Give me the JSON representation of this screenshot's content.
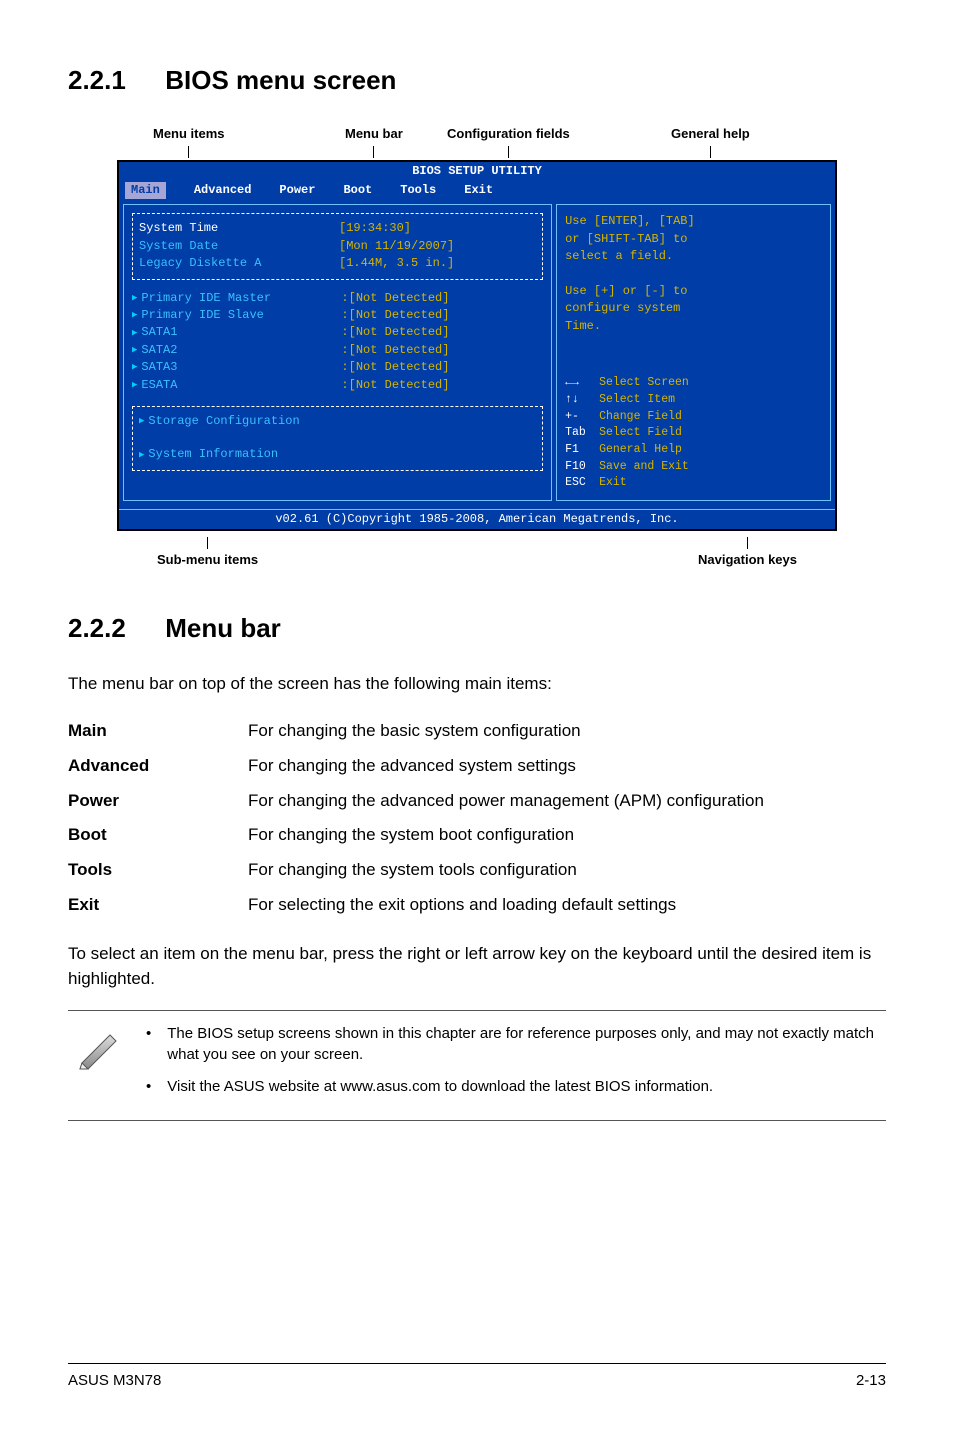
{
  "sections": {
    "s1": {
      "num": "2.2.1",
      "title": "BIOS menu screen"
    },
    "s2": {
      "num": "2.2.2",
      "title": "Menu bar"
    }
  },
  "diagram_labels": {
    "menu_items": "Menu items",
    "menu_bar": "Menu bar",
    "config_fields": "Configuration fields",
    "general_help": "General help",
    "submenu_items": "Sub-menu items",
    "nav_keys": "Navigation keys"
  },
  "bios": {
    "title": "BIOS SETUP UTILITY",
    "menus": [
      "Main",
      "Advanced",
      "Power",
      "Boot",
      "Tools",
      "Exit"
    ],
    "left_box1": [
      {
        "k": "System Time",
        "v": "[19:34:30]",
        "white": true
      },
      {
        "k": "System Date",
        "v": "[Mon 11/19/2007]"
      },
      {
        "k": "Legacy Diskette A",
        "v": "[1.44M, 3.5 in.]"
      }
    ],
    "left_list1": [
      {
        "k": "Primary IDE Master",
        "v": ":[Not Detected]"
      },
      {
        "k": "Primary IDE Slave",
        "v": ":[Not Detected]"
      },
      {
        "k": "SATA1",
        "v": ":[Not Detected]"
      },
      {
        "k": "SATA2",
        "v": ":[Not Detected]"
      },
      {
        "k": "SATA3",
        "v": ":[Not Detected]"
      },
      {
        "k": "ESATA",
        "v": ":[Not Detected]"
      }
    ],
    "left_box2": [
      "Storage Configuration",
      "System Information"
    ],
    "help_text": "Use [ENTER], [TAB]\nor [SHIFT-TAB] to\nselect a field.\n\nUse [+] or [-] to\nconfigure system\nTime.",
    "legend": [
      {
        "k": "←→",
        "v": "Select Screen",
        "icon": true
      },
      {
        "k": "↑↓",
        "v": "Select Item",
        "icon": true
      },
      {
        "k": "+-",
        "v": "Change Field"
      },
      {
        "k": "Tab",
        "v": "Select Field"
      },
      {
        "k": "F1",
        "v": "General Help"
      },
      {
        "k": "F10",
        "v": "Save and Exit"
      },
      {
        "k": "ESC",
        "v": "Exit"
      }
    ],
    "copyright": "v02.61 (C)Copyright 1985-2008, American Megatrends, Inc."
  },
  "menubar_intro": "The menu bar on top of the screen has the following main items:",
  "definitions": [
    {
      "term": "Main",
      "desc": "For changing the basic system configuration"
    },
    {
      "term": "Advanced",
      "desc": "For changing the advanced system settings"
    },
    {
      "term": "Power",
      "desc": "For changing the advanced power management (APM) configuration"
    },
    {
      "term": "Boot",
      "desc": "For changing the system boot configuration"
    },
    {
      "term": "Tools",
      "desc": "For changing the system tools configuration"
    },
    {
      "term": "Exit",
      "desc": "For selecting the exit options and loading default settings"
    }
  ],
  "select_text": "To select an item on the menu bar, press the right or left arrow key on the keyboard until the desired item is highlighted.",
  "notes": [
    "The BIOS setup screens shown in this chapter are for reference purposes only, and may not exactly match what you see on your screen.",
    "Visit the ASUS website at www.asus.com to download the latest BIOS information."
  ],
  "footer": {
    "left": "ASUS M3N78",
    "right": "2-13"
  }
}
